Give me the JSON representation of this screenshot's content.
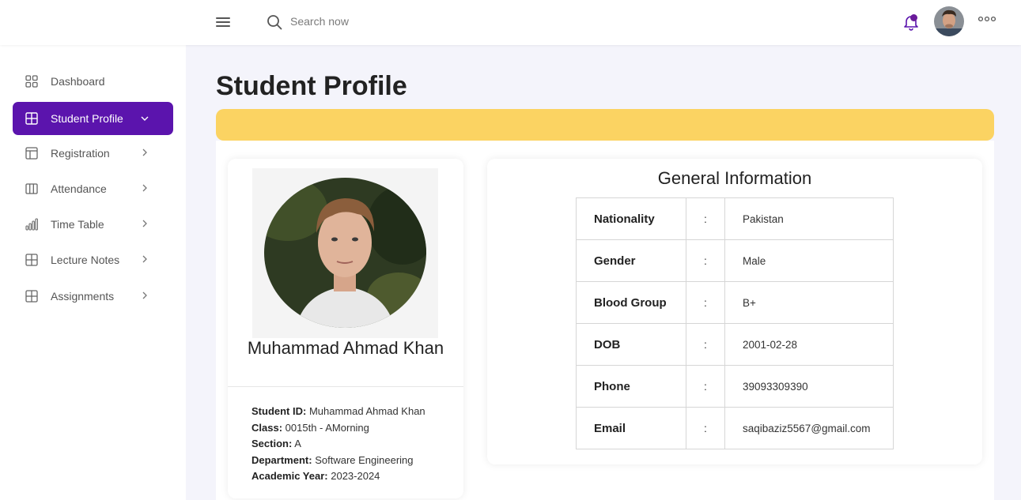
{
  "header": {
    "search_placeholder": "Search now"
  },
  "sidebar": {
    "items": [
      {
        "label": "Dashboard",
        "icon": "grid-four-icon"
      },
      {
        "label": "Student Profile",
        "icon": "table-icon",
        "active": true
      },
      {
        "label": "Registration",
        "icon": "layout-icon"
      },
      {
        "label": "Attendance",
        "icon": "columns-icon"
      },
      {
        "label": "Time Table",
        "icon": "bar-chart-icon"
      },
      {
        "label": "Lecture Notes",
        "icon": "table-icon"
      },
      {
        "label": "Assignments",
        "icon": "table-icon"
      }
    ]
  },
  "page": {
    "title": "Student Profile"
  },
  "profile": {
    "name": "Muhammad Ahmad Khan",
    "fields": [
      {
        "label": "Student ID:",
        "value": "Muhammad Ahmad Khan"
      },
      {
        "label": "Class:",
        "value": "0015th - AMorning"
      },
      {
        "label": "Section:",
        "value": "A"
      },
      {
        "label": "Department:",
        "value": "Software Engineering"
      },
      {
        "label": "Academic Year:",
        "value": "2023-2024"
      }
    ]
  },
  "general_info": {
    "title": "General Information",
    "separator": ":",
    "rows": [
      {
        "label": "Nationality",
        "value": "Pakistan"
      },
      {
        "label": "Gender",
        "value": "Male"
      },
      {
        "label": "Blood Group",
        "value": "B+"
      },
      {
        "label": "DOB",
        "value": "2001-02-28"
      },
      {
        "label": "Phone",
        "value": "39093309390"
      },
      {
        "label": "Email",
        "value": "saqibaziz5567@gmail.com"
      }
    ]
  },
  "colors": {
    "accent": "#5b14ad",
    "banner": "#fbd362",
    "notification_dot": "#6a1b9a",
    "background": "#f4f4fb"
  }
}
